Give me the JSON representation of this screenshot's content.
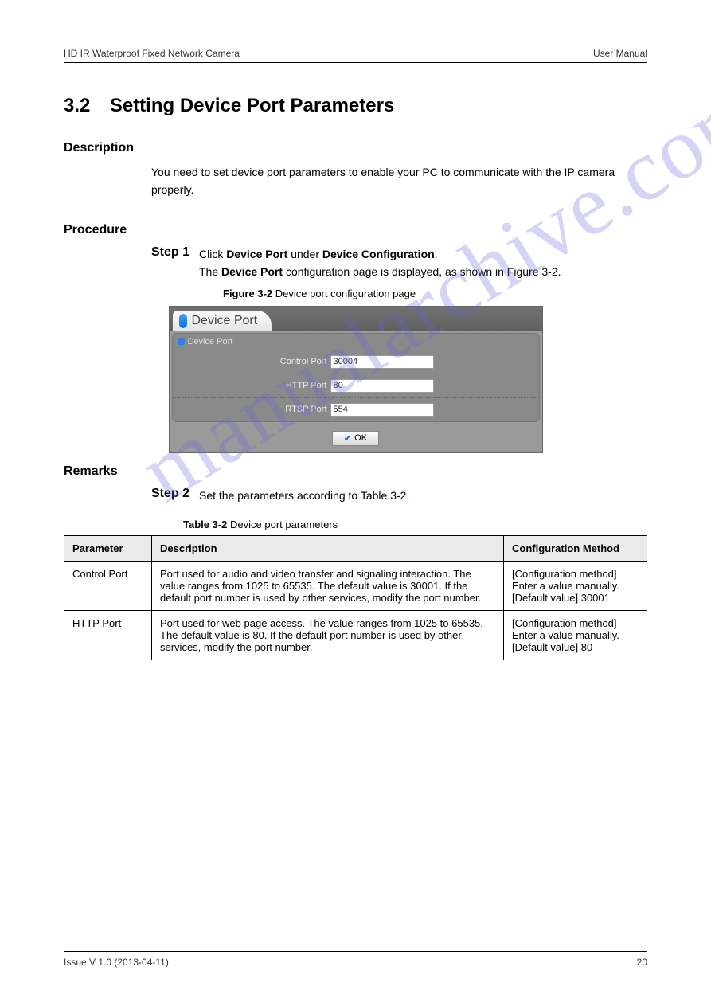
{
  "header": {
    "left": "HD IR Waterproof Fixed Network Camera",
    "right": "User Manual"
  },
  "section": {
    "number": "3.2",
    "title": "Setting Device Port Parameters"
  },
  "sub": {
    "desc_title": "Description",
    "desc_text": "You need to set device port parameters to enable your PC to communicate with the IP camera properly.",
    "proc_title": "Procedure",
    "remark_title": "Remarks"
  },
  "steps": {
    "step1_label": "Step 1",
    "step1_text_a": "Click ",
    "step1_bold": "Device Port",
    "step1_text_b": " under ",
    "step1_bold2": "Device Configuration",
    "step1_text_c": ".",
    "step1_line2_a": "The ",
    "step1_line2_bold": "Device Port",
    "step1_line2_b": " configuration page is displayed, as shown in Figure 3-2.",
    "step2_label": "Step 2",
    "step2_text": "Set the parameters according to Table 3-2."
  },
  "figure": {
    "label": "Figure 3-2",
    "caption": "Device port configuration page"
  },
  "dialog": {
    "tab": "Device Port",
    "group": "Device Port",
    "rows": {
      "control_label": "Control Port",
      "control_value": "30004",
      "http_label": "HTTP Port",
      "http_value": "80",
      "rtsp_label": "RTSP Port",
      "rtsp_value": "554"
    },
    "ok": "OK"
  },
  "table": {
    "label": "Table 3-2",
    "caption": "Device port parameters",
    "headers": {
      "c1": "Parameter",
      "c2": "Description",
      "c3": "Configuration Method"
    },
    "rows": [
      {
        "param": "Control Port",
        "desc": "Port used for audio and video transfer and signaling interaction. The value ranges from 1025 to 65535. The default value is 30001. If the default port number is used by other services, modify the port number.",
        "method": "[Configuration method] Enter a value manually. [Default value] 30001"
      },
      {
        "param": "HTTP Port",
        "desc": "Port used for web page access. The value ranges from 1025 to 65535. The default value is 80. If the default port number is used by other services, modify the port number.",
        "method": "[Configuration method] Enter a value manually. [Default value] 80"
      }
    ]
  },
  "footer": {
    "left": "Issue V 1.0 (2013-04-11)",
    "right": "20"
  },
  "watermark": "manualarchive.com"
}
